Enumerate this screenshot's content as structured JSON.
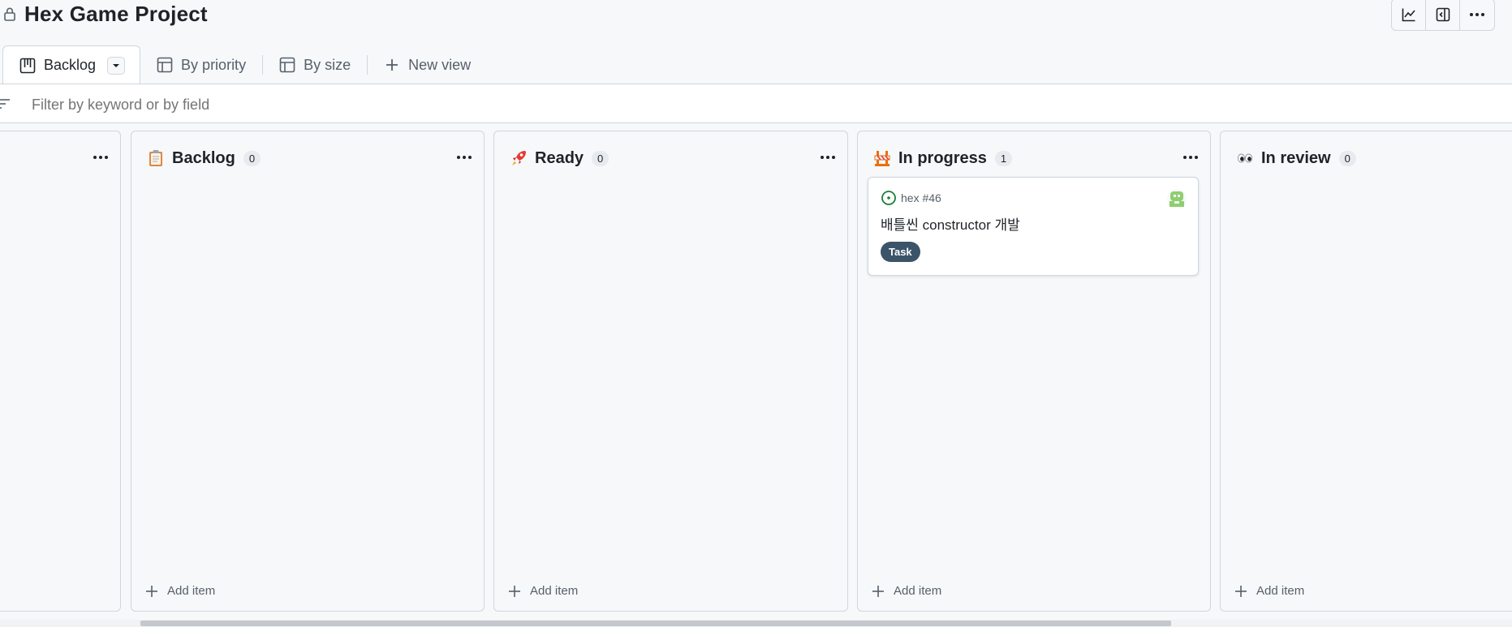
{
  "header": {
    "title": "Hex Game Project",
    "actions": [
      "insights-icon",
      "side-panel-icon",
      "more-options-icon"
    ]
  },
  "tabs": [
    {
      "label": "Backlog",
      "icon": "board-icon",
      "active": true
    },
    {
      "label": "By priority",
      "icon": "table-icon",
      "active": false
    },
    {
      "label": "By size",
      "icon": "table-icon",
      "active": false
    },
    {
      "label": "New view",
      "icon": "plus-icon",
      "active": false
    }
  ],
  "filter": {
    "placeholder": "Filter by keyword or by field"
  },
  "columns": [
    {
      "title": "",
      "count": "",
      "add_item": ""
    },
    {
      "title": "Backlog",
      "emoji": "clipboard-icon",
      "count": "0",
      "add_item": "Add item"
    },
    {
      "title": "Ready",
      "emoji": "rocket-icon",
      "count": "0",
      "add_item": "Add item"
    },
    {
      "title": "In progress",
      "emoji": "construction-icon",
      "count": "1",
      "add_item": "Add item",
      "cards": [
        {
          "repo_ref": "hex #46",
          "title": "배틀씬 constructor 개발",
          "label": "Task",
          "status": "open-issue-icon"
        }
      ]
    },
    {
      "title": "In review",
      "emoji": "eyes-icon",
      "count": "0",
      "add_item": "Add item"
    }
  ],
  "colors": {
    "label_bg": "#3b5469",
    "open_issue": "#1a7f37",
    "border": "#d0d7de"
  }
}
